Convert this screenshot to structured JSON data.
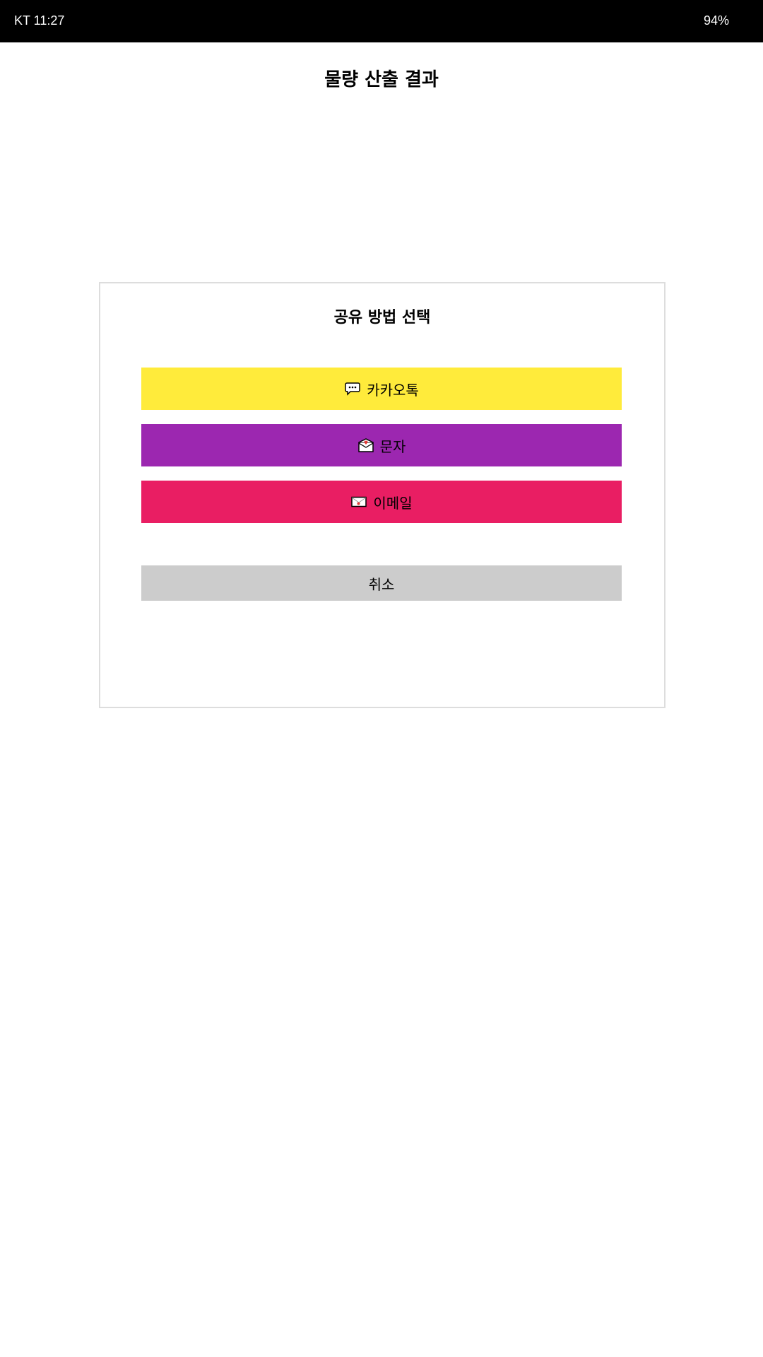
{
  "status_bar": {
    "left_text": "KT 11:27",
    "right_text": "94%"
  },
  "page": {
    "title": "물량 산출 결과"
  },
  "share_dialog": {
    "title": "공유 방법 선택",
    "buttons": [
      {
        "label": "카카오톡",
        "icon": "speech-balloon-icon",
        "color": "#FFEB3B"
      },
      {
        "label": "문자",
        "icon": "envelope-with-heart-icon",
        "color": "#9C27B0"
      },
      {
        "label": "이메일",
        "icon": "email-envelope-icon",
        "color": "#E91E63"
      }
    ],
    "cancel": {
      "label": "취소",
      "color": "#CCCCCC"
    }
  }
}
